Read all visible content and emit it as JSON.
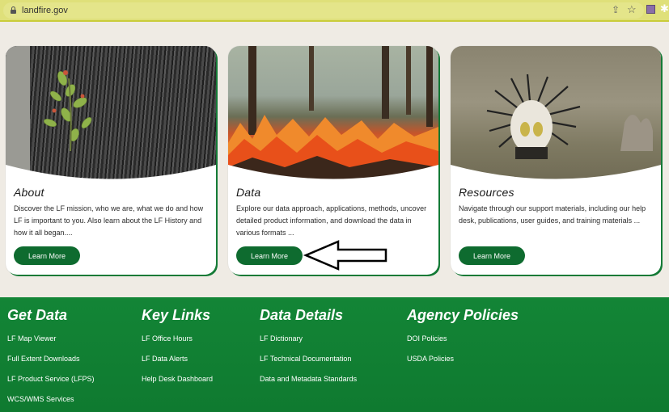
{
  "browser": {
    "url": "landfire.gov"
  },
  "cards": [
    {
      "title": "About",
      "text": "Discover the LF mission, who we are, what we do and how LF is important to you. Also learn about the LF History and how it all began....",
      "button": "Learn More"
    },
    {
      "title": "Data",
      "text": "Explore our data approach, applications, methods, uncover detailed product information, and download the data in various formats ...",
      "button": "Learn More"
    },
    {
      "title": "Resources",
      "text": "Navigate through our support materials, including our help desk, publications, user guides, and training materials ...",
      "button": "Learn More"
    }
  ],
  "footer": {
    "columns": [
      {
        "heading": "Get Data",
        "links": [
          "LF Map Viewer",
          "Full Extent Downloads",
          "LF Product Service (LFPS)",
          "WCS/WMS Services"
        ]
      },
      {
        "heading": "Key Links",
        "links": [
          "LF Office Hours",
          "LF Data Alerts",
          "Help Desk Dashboard"
        ]
      },
      {
        "heading": "Data Details",
        "links": [
          "LF Dictionary",
          "LF Technical Documentation",
          "Data and Metadata Standards"
        ]
      },
      {
        "heading": "Agency Policies",
        "links": [
          "DOI Policies",
          "USDA Policies"
        ]
      }
    ]
  },
  "colors": {
    "brand_green": "#0e6b2f",
    "footer_green": "#138536",
    "page_bg": "#efebe4"
  }
}
